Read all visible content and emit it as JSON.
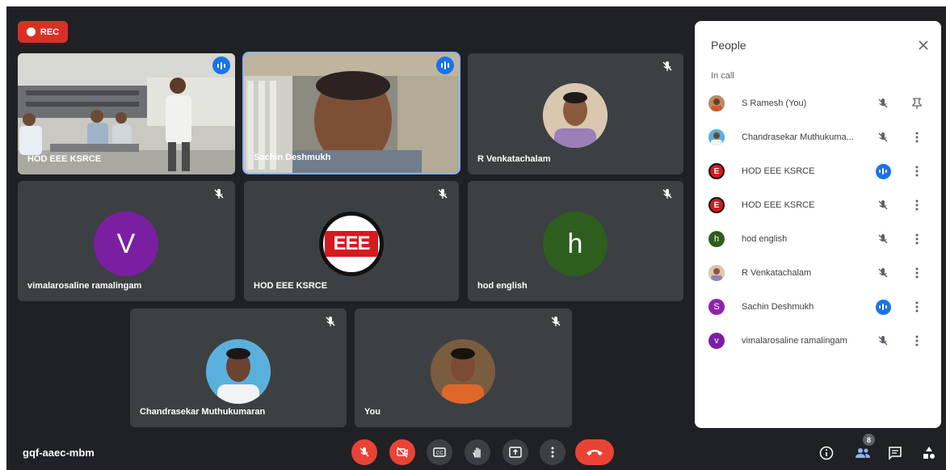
{
  "recording": {
    "label": "REC"
  },
  "tiles": {
    "t1": {
      "name": "HOD EEE KSRCE"
    },
    "t2": {
      "name": "Sachin Deshmukh"
    },
    "t3": {
      "name": "R Venkatachalam"
    },
    "t4": {
      "name": "vimalarosaline ramalingam",
      "initial": "V"
    },
    "t5": {
      "name": "HOD EEE KSRCE",
      "logo_text": "EEE"
    },
    "t6": {
      "name": "hod english",
      "initial": "h"
    },
    "t7": {
      "name": "Chandrasekar Muthukumaran"
    },
    "t8": {
      "name": "You"
    }
  },
  "people_panel": {
    "title": "People",
    "section_label": "In call",
    "participants": [
      {
        "name": "S Ramesh (You)",
        "avatar": "photo",
        "mic": "muted",
        "action": "pin-icon"
      },
      {
        "name": "Chandrasekar Muthukuma...",
        "avatar": "photo",
        "mic": "muted",
        "action": "more-icon"
      },
      {
        "name": "HOD EEE KSRCE",
        "avatar": "E",
        "mic": "speaking",
        "action": "more-icon"
      },
      {
        "name": "HOD EEE KSRCE",
        "avatar": "E",
        "mic": "muted",
        "action": "more-icon"
      },
      {
        "name": "hod english",
        "avatar": "h",
        "mic": "muted",
        "action": "more-icon"
      },
      {
        "name": "R Venkatachalam",
        "avatar": "photo",
        "mic": "muted",
        "action": "more-icon"
      },
      {
        "name": "Sachin Deshmukh",
        "avatar": "S",
        "mic": "speaking",
        "action": "more-icon"
      },
      {
        "name": "vimalarosaline ramalingam",
        "avatar": "v",
        "mic": "muted",
        "action": "more-icon"
      }
    ]
  },
  "bottom_bar": {
    "meeting_code": "gqf-aaec-mbm",
    "participant_count": "8"
  },
  "colors": {
    "background": "#202124",
    "tile": "#3c4043",
    "accent_blue": "#1a73e8",
    "danger_red": "#ea4335",
    "purple_avatar": "#7b1fa2",
    "green_avatar": "#2e5e1e"
  }
}
